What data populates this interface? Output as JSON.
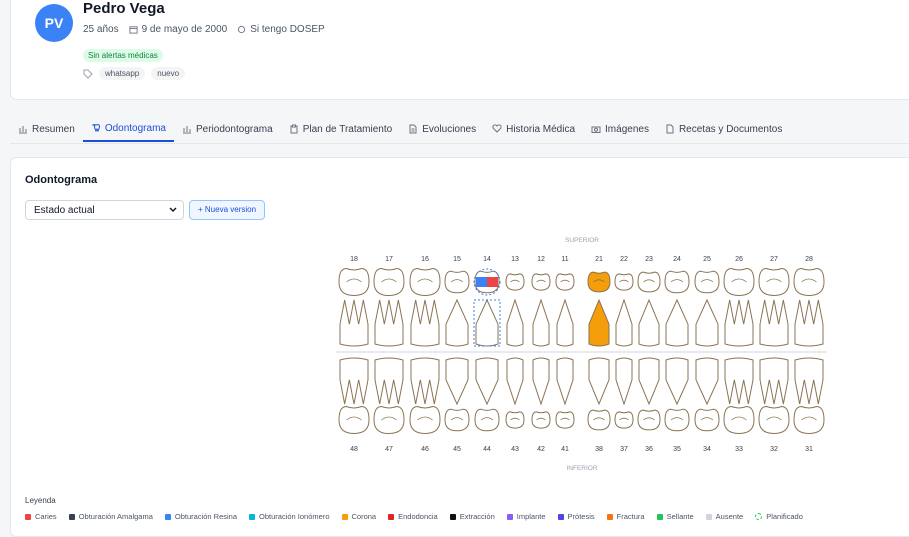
{
  "patient": {
    "initials": "PV",
    "name": "Pedro Vega",
    "age": "25 años",
    "birthdate": "9 de mayo de 2000",
    "insurance": "Si tengo DOSEP",
    "alert_badge": "Sin alertas médicas",
    "tags": [
      "whatsapp",
      "nuevo"
    ]
  },
  "tabs": [
    {
      "label": "Resumen",
      "icon": "bar-chart-icon",
      "active": false
    },
    {
      "label": "Odontograma",
      "icon": "tooth-icon",
      "active": true
    },
    {
      "label": "Periodontograma",
      "icon": "bar-chart-icon",
      "active": false
    },
    {
      "label": "Plan de Tratamiento",
      "icon": "clipboard-icon",
      "active": false
    },
    {
      "label": "Evoluciones",
      "icon": "document-icon",
      "active": false
    },
    {
      "label": "Historia Médica",
      "icon": "heart-icon",
      "active": false
    },
    {
      "label": "Imágenes",
      "icon": "camera-icon",
      "active": false
    },
    {
      "label": "Recetas y Documentos",
      "icon": "file-icon",
      "active": false
    }
  ],
  "odontogram": {
    "title": "Odontograma",
    "version_select": "Estado actual",
    "new_version_button": "+ Nueva version",
    "upper_label": "SUPERIOR",
    "lower_label": "INFERIOR",
    "upper_numbers": [
      "18",
      "17",
      "16",
      "15",
      "14",
      "13",
      "12",
      "11",
      "21",
      "22",
      "23",
      "24",
      "25",
      "26",
      "27",
      "28"
    ],
    "lower_numbers": [
      "48",
      "47",
      "46",
      "45",
      "44",
      "43",
      "42",
      "41",
      "38",
      "37",
      "36",
      "35",
      "34",
      "33",
      "32",
      "31"
    ],
    "marked": {
      "14": "obturacion-selected",
      "21": "corona"
    }
  },
  "legend": {
    "title": "Leyenda",
    "items": [
      {
        "label": "Caries",
        "color": "#ef4444"
      },
      {
        "label": "Obturación Amalgama",
        "color": "#374151"
      },
      {
        "label": "Obturación Resina",
        "color": "#3b82f6"
      },
      {
        "label": "Obturación Ionómero",
        "color": "#06b6d4"
      },
      {
        "label": "Corona",
        "color": "#f59e0b"
      },
      {
        "label": "Endodoncia",
        "color": "#dc2626"
      },
      {
        "label": "Extracción",
        "color": "#111111"
      },
      {
        "label": "Implante",
        "color": "#8b5cf6"
      },
      {
        "label": "Prótesis",
        "color": "#4f46e5"
      },
      {
        "label": "Fractura",
        "color": "#f97316"
      },
      {
        "label": "Sellante",
        "color": "#22c55e"
      },
      {
        "label": "Ausente",
        "color": "#d1d5db"
      },
      {
        "label": "Planificado",
        "color": "dashed"
      }
    ]
  }
}
